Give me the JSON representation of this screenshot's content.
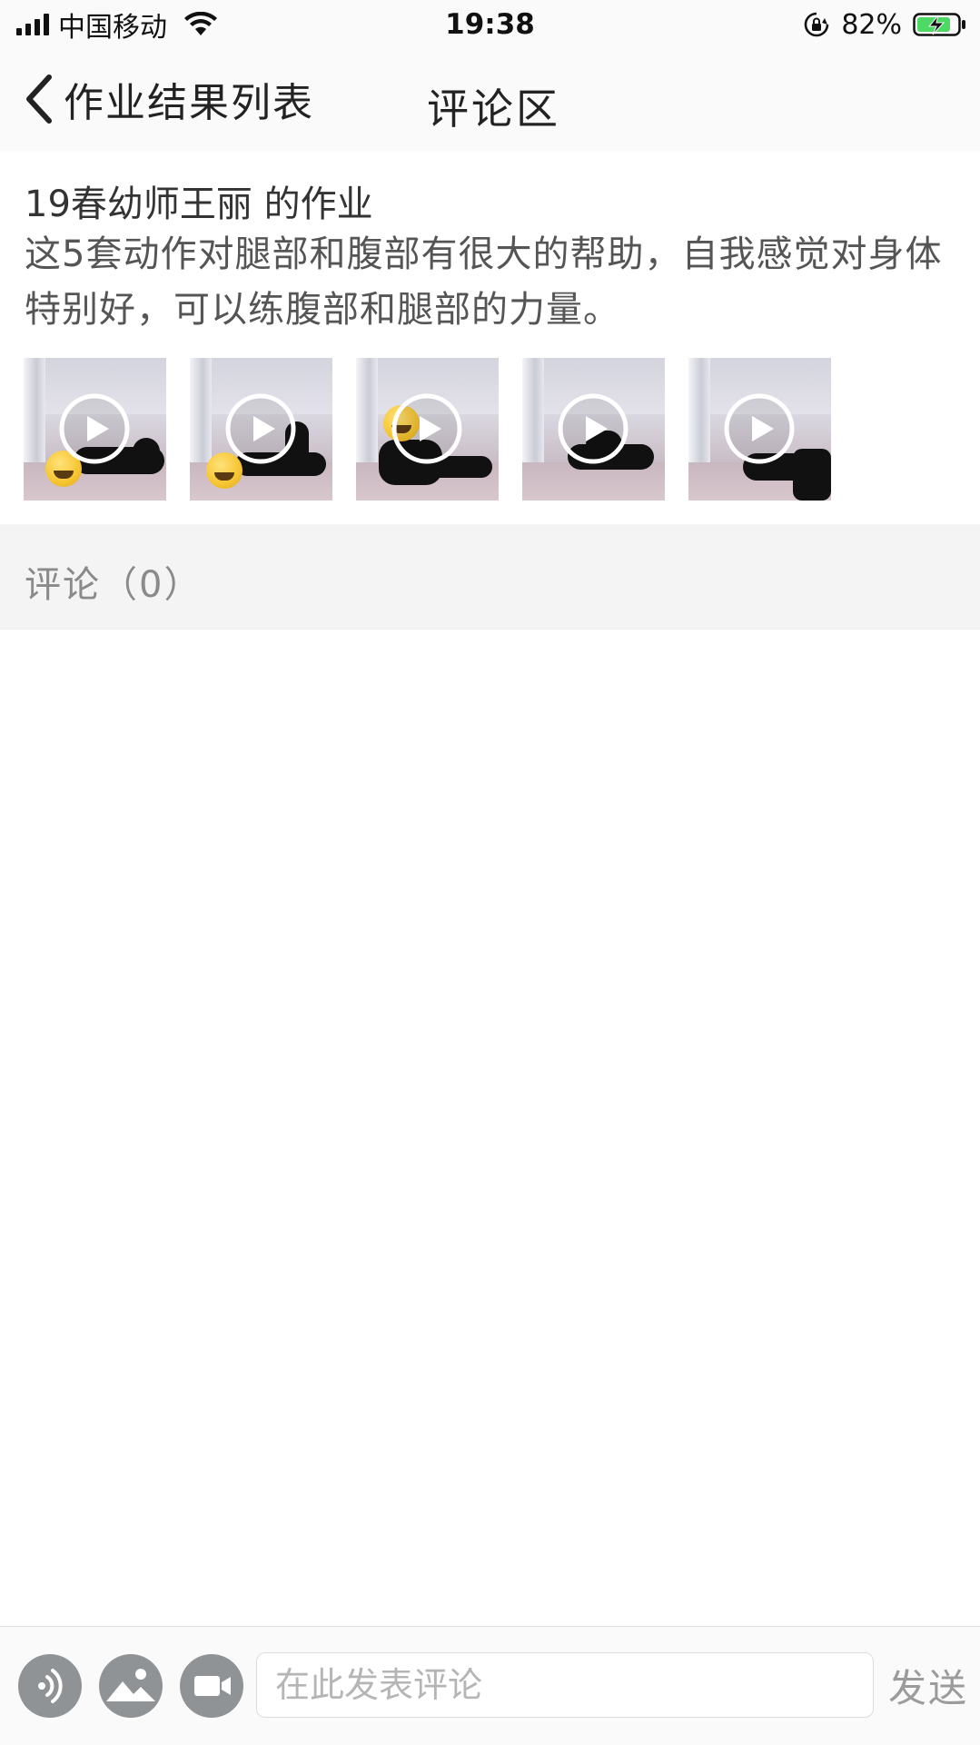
{
  "status_bar": {
    "carrier": "中国移动",
    "time": "19:38",
    "battery_percent": "82%",
    "battery_level": 0.82,
    "icons": [
      "signal-icon",
      "wifi-icon",
      "orientation-lock-icon",
      "battery-charging-icon"
    ]
  },
  "nav": {
    "back_label": "作业结果列表",
    "title": "评论区"
  },
  "homework": {
    "title": "19春幼师王丽 的作业",
    "description": "这5套动作对腿部和腹部有很大的帮助，自我感觉对身体特别好，可以练腹部和腿部的力量。",
    "videos": [
      {
        "id": "video-1",
        "icon": "play-icon"
      },
      {
        "id": "video-2",
        "icon": "play-icon"
      },
      {
        "id": "video-3",
        "icon": "play-icon"
      },
      {
        "id": "video-4",
        "icon": "play-icon"
      },
      {
        "id": "video-5",
        "icon": "play-icon"
      }
    ]
  },
  "comments": {
    "header": "评论（0）",
    "count": 0
  },
  "composer": {
    "placeholder": "在此发表评论",
    "send_label": "发送",
    "buttons": [
      "voice-icon",
      "image-icon",
      "video-camera-icon"
    ]
  },
  "colors": {
    "background": "#ffffff",
    "nav_background": "#fafafa",
    "comment_header_bg": "#f4f4f4",
    "muted_text": "#8a8a8a",
    "composer_icon_bg": "#909396",
    "battery_green": "#4cd964"
  }
}
